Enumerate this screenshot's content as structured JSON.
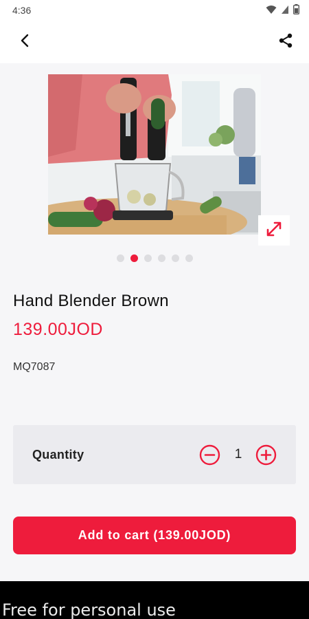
{
  "status_bar": {
    "time": "4:36",
    "icons": [
      "wifi-icon",
      "signal-icon",
      "battery-icon"
    ]
  },
  "app_bar": {
    "back_icon": "back-arrow-icon",
    "share_icon": "share-icon"
  },
  "gallery": {
    "image": "hand-blender-in-use-photo",
    "image_count": 6,
    "active_index": 1,
    "expand_icon": "expand-arrows-icon"
  },
  "product": {
    "name": "Hand Blender Brown",
    "price": "139.00JOD",
    "sku": "MQ7087"
  },
  "quantity": {
    "label": "Quantity",
    "value": "1",
    "minus_icon": "minus-circle-icon",
    "plus_icon": "plus-circle-icon"
  },
  "cart": {
    "button_label": "Add to cart (139.00JOD)"
  },
  "banner": {
    "text": "Free for personal use"
  },
  "colors": {
    "accent": "#ee1c3c",
    "background": "#f6f6f8",
    "card": "#ebebef"
  }
}
